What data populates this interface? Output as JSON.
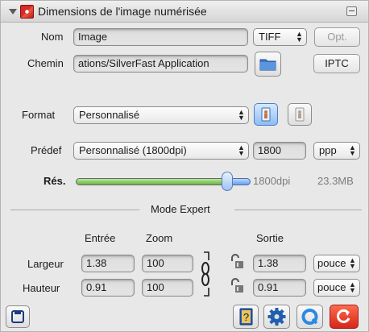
{
  "header": {
    "title": "Dimensions de l'image numérisée"
  },
  "name_row": {
    "label": "Nom",
    "value": "Image",
    "filetype": "TIFF",
    "opt_label": "Opt."
  },
  "path_row": {
    "label": "Chemin",
    "value": "ations/SilverFast Application",
    "iptc_label": "IPTC"
  },
  "format_row": {
    "label": "Format",
    "value": "Personnalisé"
  },
  "preset_row": {
    "label": "Prédef",
    "value": "Personnalisé (1800dpi)",
    "resolution": "1800",
    "unit": "ppp"
  },
  "resolution_row": {
    "label": "Rés.",
    "slider_value": 1800,
    "value_text": "1800dpi",
    "size_text": "23.3MB"
  },
  "expert": {
    "title": "Mode Expert",
    "columns": {
      "input": "Entrée",
      "zoom": "Zoom",
      "output": "Sortie"
    },
    "width": {
      "label": "Largeur",
      "input": "1.38",
      "zoom": "100",
      "output": "1.38",
      "unit": "pouce"
    },
    "height": {
      "label": "Hauteur",
      "input": "0.91",
      "zoom": "100",
      "output": "0.91",
      "unit": "pouce"
    }
  },
  "toolbar": {
    "help_icon": "question-book-icon",
    "settings_icon": "gear-icon",
    "reset_icon": "q-reset-icon",
    "refresh_icon": "refresh-icon",
    "save_icon": "floppy-icon"
  },
  "colors": {
    "accent_blue": "#4a90e2",
    "slider_green": "#7cc45a",
    "settings_blue": "#1f5fb0",
    "refresh_red": "#e53a2a"
  }
}
